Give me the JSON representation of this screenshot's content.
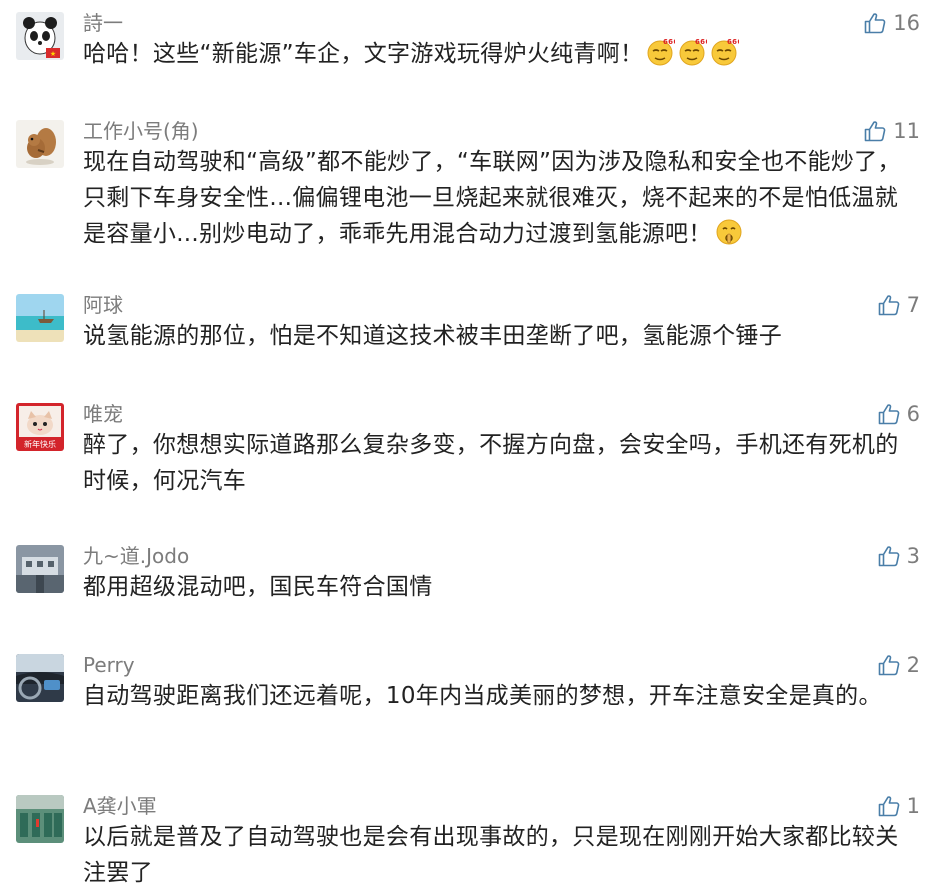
{
  "comments": [
    {
      "name": "詩一",
      "likes": "16",
      "text": "哈哈！这些“新能源”车企，文字游戏玩得炉火纯青啊！",
      "emojis": [
        "666-emoji",
        "666-emoji",
        "666-emoji"
      ],
      "avatar": "panda-avatar"
    },
    {
      "name": "工作小号(角)",
      "likes": "11",
      "text": "现在自动驾驶和“高级”都不能炒了，“车联网”因为涉及隐私和安全也不能炒了，只剩下车身安全性...偏偏锂电池一旦烧起来就很难灭，烧不起来的不是怕低温就是容量小...别炒电动了，乖乖先用混合动力过渡到氢能源吧！",
      "emojis": [
        "shush-emoji"
      ],
      "avatar": "squirrel-avatar"
    },
    {
      "name": "阿球",
      "likes": "7",
      "text": "说氢能源的那位，怕是不知道这技术被丰田垄断了吧，氢能源个锤子",
      "emojis": [],
      "avatar": "beach-avatar"
    },
    {
      "name": "唯宠",
      "likes": "6",
      "text": "醉了，你想想实际道路那么复杂多变，不握方向盘，会安全吗，手机还有死机的时候，何况汽车",
      "emojis": [],
      "avatar": "cat-avatar",
      "avatar_caption": "新年快乐"
    },
    {
      "name": "九~道.Jodo",
      "likes": "3",
      "text": "都用超级混动吧，国民车符合国情",
      "emojis": [],
      "avatar": "building-avatar"
    },
    {
      "name": "Perry",
      "likes": "2",
      "text": "自动驾驶距离我们还远着呢，10年内当成美丽的梦想，开车注意安全是真的。",
      "emojis": [],
      "avatar": "car-interior-avatar"
    },
    {
      "name": "A龚小軍",
      "likes": "1",
      "text": "以后就是普及了自动驾驶也是会有出现事故的，只是现在刚刚开始大家都比较关注罢了",
      "emojis": [],
      "avatar": "factory-avatar"
    }
  ]
}
